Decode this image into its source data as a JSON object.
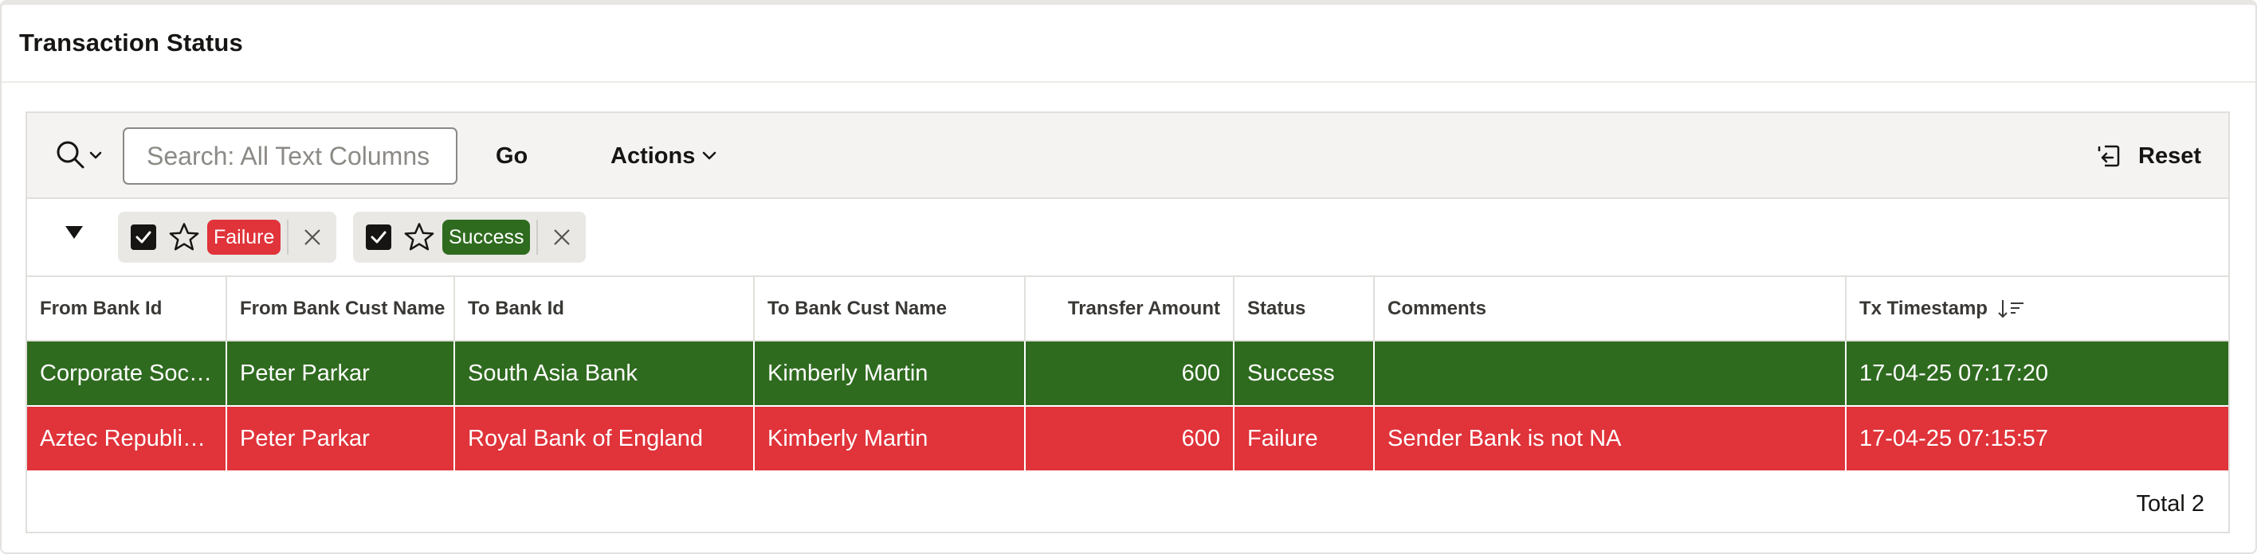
{
  "region": {
    "title": "Transaction Status"
  },
  "toolbar": {
    "search_placeholder": "Search: All Text Columns",
    "go_label": "Go",
    "actions_label": "Actions",
    "reset_label": "Reset"
  },
  "filters": [
    {
      "label": "Failure",
      "color": "#e0333a",
      "checked": true
    },
    {
      "label": "Success",
      "color": "#2f6b1f",
      "checked": true
    }
  ],
  "table": {
    "columns": [
      {
        "label": "From Bank Id"
      },
      {
        "label": "From Bank Cust Name"
      },
      {
        "label": "To Bank Id"
      },
      {
        "label": "To Bank Cust Name"
      },
      {
        "label": "Transfer Amount"
      },
      {
        "label": "Status"
      },
      {
        "label": "Comments"
      },
      {
        "label": "Tx Timestamp",
        "sort": "descending"
      }
    ],
    "rows": [
      {
        "status_color": "#2f6b1f",
        "from_bank_id": "Corporate Soci…",
        "from_bank_cust_name": "Peter Parkar",
        "to_bank_id": "South Asia Bank",
        "to_bank_cust_name": "Kimberly Martin",
        "transfer_amount": "600",
        "status": "Success",
        "comments": "",
        "tx_timestamp": "17-04-25 07:17:20"
      },
      {
        "status_color": "#e0333a",
        "from_bank_id": "Aztec Republic…",
        "from_bank_cust_name": "Peter Parkar",
        "to_bank_id": "Royal Bank of England",
        "to_bank_cust_name": "Kimberly Martin",
        "transfer_amount": "600",
        "status": "Failure",
        "comments": "Sender Bank is not NA",
        "tx_timestamp": "17-04-25 07:15:57"
      }
    ]
  },
  "footer": {
    "total_label": "Total 2"
  }
}
